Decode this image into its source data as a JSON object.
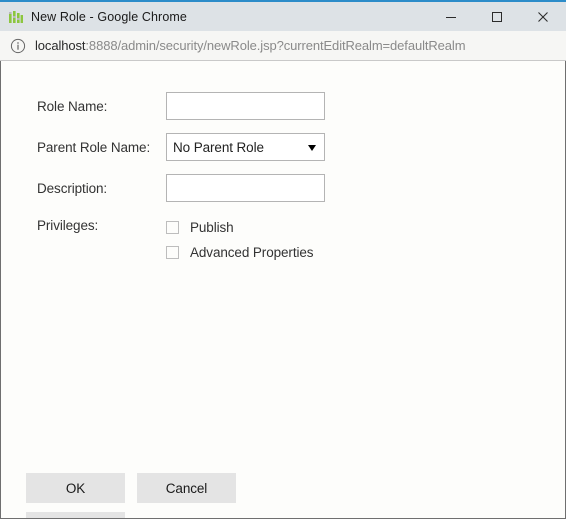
{
  "window": {
    "title": "New Role - Google Chrome",
    "favicon_name": "equalizer-bars-icon",
    "accent_color": "#2c8cc9",
    "titlebar_color": "#dde2e6",
    "controls": {
      "minimize_label": "—",
      "maximize_label": "☐",
      "close_label": "×"
    }
  },
  "urlbar": {
    "info_icon_name": "info-circle-icon",
    "host": "localhost",
    "path": ":8888/admin/security/newRole.jsp?currentEditRealm=defaultRealm",
    "full_url": "localhost:8888/admin/security/newRole.jsp?currentEditRealm=defaultRealm"
  },
  "form": {
    "fields": [
      {
        "label": "Role Name:",
        "type": "text",
        "value": "",
        "placeholder": ""
      },
      {
        "label": "Parent Role Name:",
        "type": "select",
        "value": "No Parent Role",
        "options": [
          "No Parent Role"
        ]
      },
      {
        "label": "Description:",
        "type": "text",
        "value": "",
        "placeholder": ""
      }
    ],
    "privileges": {
      "label": "Privileges:",
      "items": [
        {
          "label": "Publish",
          "checked": false
        },
        {
          "label": "Advanced Properties",
          "checked": false
        }
      ]
    }
  },
  "footer": {
    "ok_label": "OK",
    "cancel_label": "Cancel"
  }
}
